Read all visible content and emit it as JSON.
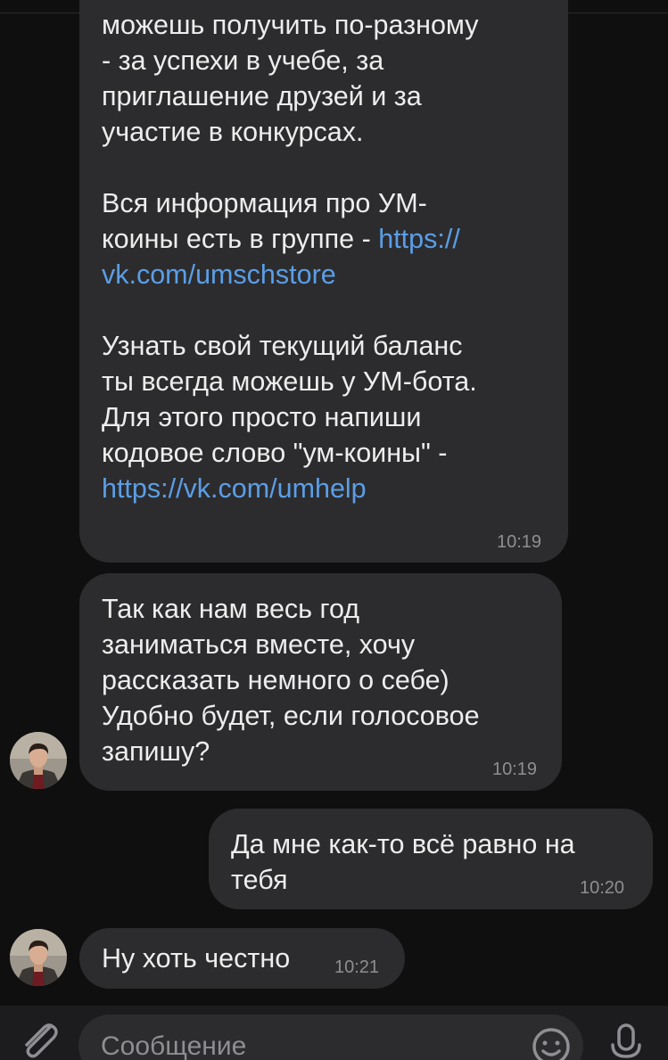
{
  "messages": [
    {
      "lines_a": [
        "можешь получить по-разному",
        "- за успехи в учебе, за",
        "приглашение друзей и за",
        "участие в конкурсах."
      ],
      "line_b1": "Вся информация про УМ-",
      "line_b2_text": "коины есть в группе - ",
      "link1_part1": "https://",
      "link1_part2": "vk.com/umschstore",
      "lines_c": [
        "Узнать свой текущий баланс",
        "ты всегда можешь у УМ-бота.",
        "Для этого просто напиши",
        "кодовое слово \"ум-коины\" -"
      ],
      "link2": "https://vk.com/umhelp",
      "time": "10:19"
    },
    {
      "lines": [
        "Так как нам весь год",
        "заниматься вместе, хочу",
        "рассказать немного о себе)",
        "Удобно будет, если голосовое",
        "запишу?"
      ],
      "time": "10:19"
    },
    {
      "lines": [
        "Да мне как-то всё равно на",
        "тебя"
      ],
      "time": "10:20"
    },
    {
      "text": "Ну хоть честно",
      "time": "10:21"
    }
  ],
  "composer": {
    "placeholder": "Сообщение"
  },
  "colors": {
    "background": "#0f0f10",
    "bubble": "#2c2c2e",
    "link": "#5b9ee6",
    "time": "#8e8e93"
  },
  "icons": {
    "attach": "paperclip-icon",
    "emoji": "smiley-icon",
    "voice": "microphone-icon"
  }
}
